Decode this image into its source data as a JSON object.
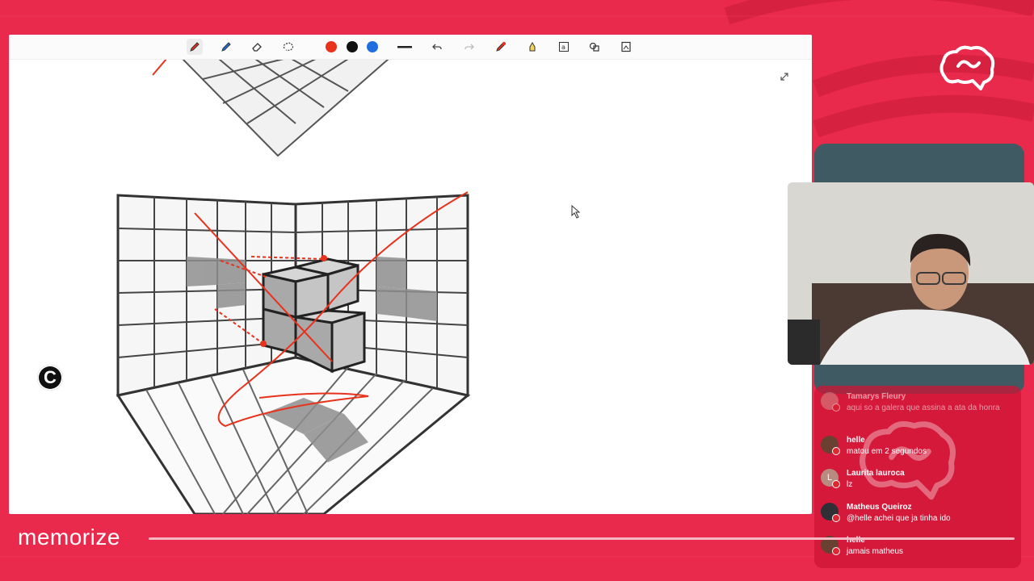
{
  "brand": {
    "name": "memorize"
  },
  "toolbar": {
    "tools": [
      {
        "icon": "pencil-icon",
        "active": true
      },
      {
        "icon": "marker-icon",
        "active": false
      },
      {
        "icon": "eraser-icon",
        "active": false
      },
      {
        "icon": "lasso-icon",
        "active": false
      },
      {
        "icon": "color-red",
        "color": "#e8321c"
      },
      {
        "icon": "color-black",
        "color": "#111111"
      },
      {
        "icon": "color-blue",
        "color": "#1f6fe0"
      },
      {
        "icon": "stroke-width-icon"
      },
      {
        "icon": "undo-icon"
      },
      {
        "icon": "redo-icon"
      },
      {
        "icon": "laser-pointer-icon"
      },
      {
        "icon": "highlighter-icon"
      },
      {
        "icon": "text-icon"
      },
      {
        "icon": "shapes-icon"
      },
      {
        "icon": "image-icon"
      }
    ]
  },
  "board": {
    "badge": "C"
  },
  "chat": {
    "messages": [
      {
        "author": "Tamarys Fleury",
        "text": "aqui so a galera que assina a ata da honra",
        "avatar": ""
      },
      {
        "author": "helle",
        "text": "matou em 2 segundos",
        "avatar": ""
      },
      {
        "author": "Laurita lauroca",
        "text": "lz",
        "avatar": "L"
      },
      {
        "author": "Matheus Queiroz",
        "text": "@helle achei que ja tinha ido",
        "avatar": ""
      },
      {
        "author": "helle",
        "text": "jamais matheus",
        "avatar": ""
      }
    ]
  },
  "colors": {
    "background": "#ea2a4c",
    "accent": "#e8321c",
    "panel": "#3f5a63"
  }
}
